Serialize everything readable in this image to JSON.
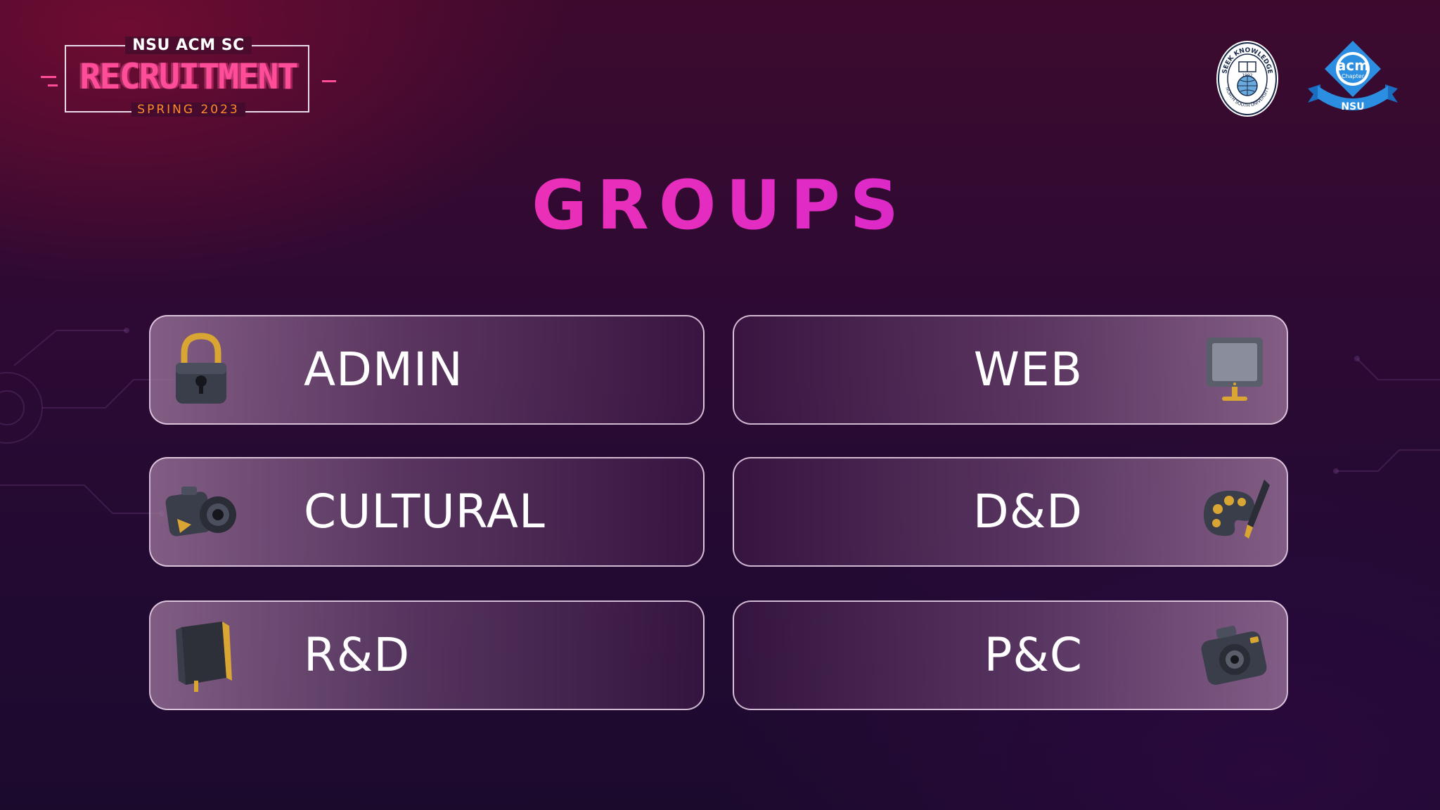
{
  "header": {
    "org": "NSU ACM SC",
    "headline": "RECRUITMENT",
    "season": "SPRING 2023"
  },
  "logos": {
    "university_seal_text_top": "SEEK KNOWLEDGE",
    "university_seal_text_bottom": "NORTH SOUTH UNIVERSITY",
    "university_seal_year": "1992",
    "acm_line1": "acm",
    "acm_line2": "Chapter",
    "acm_ribbon": "NSU"
  },
  "title": "GROUPS",
  "groups": [
    {
      "label": "ADMIN",
      "icon": "padlock-icon"
    },
    {
      "label": "WEB",
      "icon": "monitor-icon"
    },
    {
      "label": "CULTURAL",
      "icon": "video-camera-icon"
    },
    {
      "label": "D&D",
      "icon": "paint-palette-icon"
    },
    {
      "label": "R&D",
      "icon": "book-icon"
    },
    {
      "label": "P&C",
      "icon": "photo-camera-icon"
    }
  ],
  "colors": {
    "accent_pink": "#ff2fa8",
    "accent_orange": "#ff8a2a",
    "acm_blue": "#1e7ed6"
  }
}
